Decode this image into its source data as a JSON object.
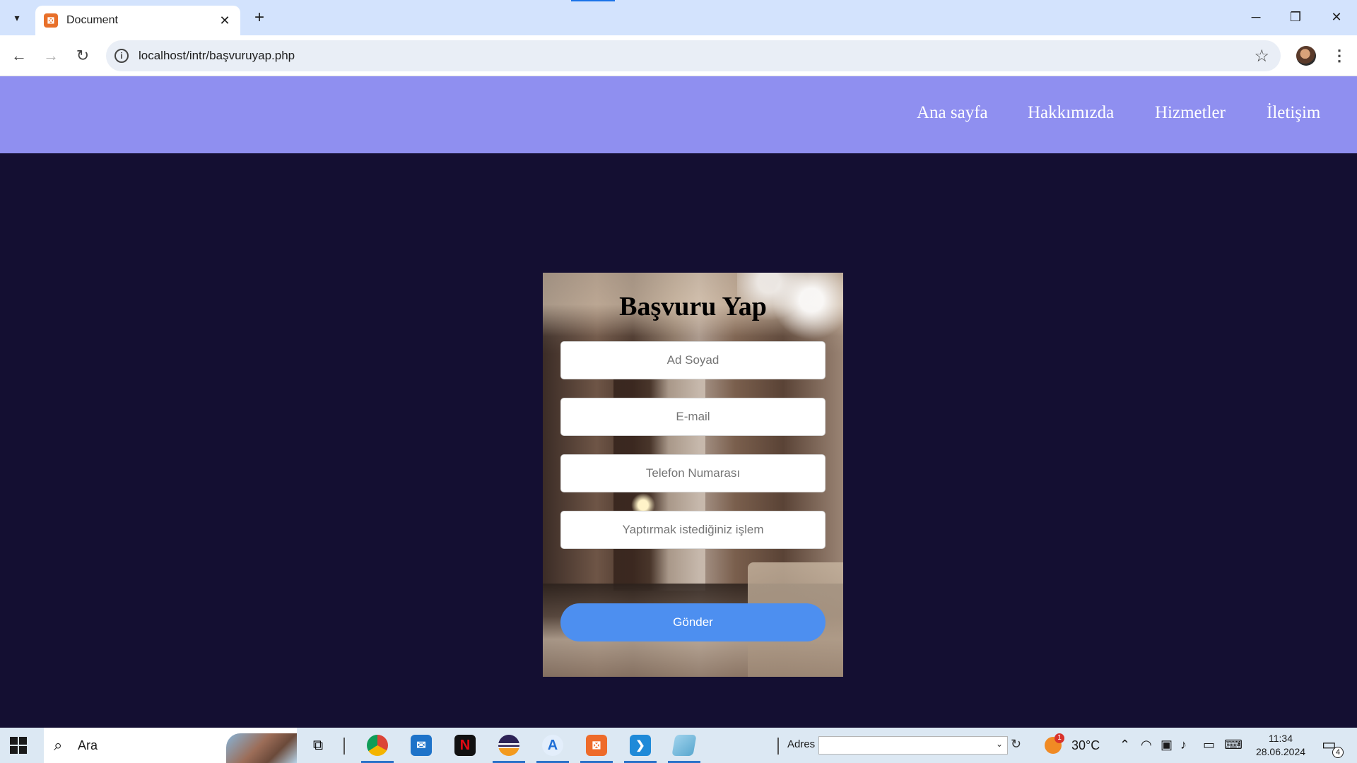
{
  "browser": {
    "tab_title": "Document",
    "url": "localhost/intr/başvuruyap.php",
    "favicon_name": "xampp-icon",
    "tab_close": "✕",
    "new_tab": "+",
    "min": "─",
    "restore": "❐",
    "close": "✕"
  },
  "header": {
    "background": "#8f8ff0",
    "nav": [
      "Ana sayfa",
      "Hakkımızda",
      "Hizmetler",
      "İletişim"
    ]
  },
  "form": {
    "title": "Başvuru Yap",
    "fields": [
      {
        "placeholder": "Ad Soyad",
        "value": ""
      },
      {
        "placeholder": "E-mail",
        "value": ""
      },
      {
        "placeholder": "Telefon Numarası",
        "value": ""
      },
      {
        "placeholder": "Yaptırmak istediğiniz işlem",
        "value": ""
      }
    ],
    "submit_label": "Gönder",
    "submit_color": "#4d8ff0"
  },
  "page": {
    "background": "#140f32"
  },
  "taskbar": {
    "search_label": "Ara",
    "apps": [
      "task-view-icon",
      "chrome-icon",
      "mail-icon",
      "netflix-icon",
      "eclipse-icon",
      "app-store-icon",
      "xampp-icon",
      "vscode-icon",
      "notepad-icon"
    ],
    "address_label": "Adres",
    "address_value": "",
    "temperature": "30°C",
    "weather_badge": "1",
    "time": "11:34",
    "date": "28.06.2024",
    "notification_count": "4"
  }
}
